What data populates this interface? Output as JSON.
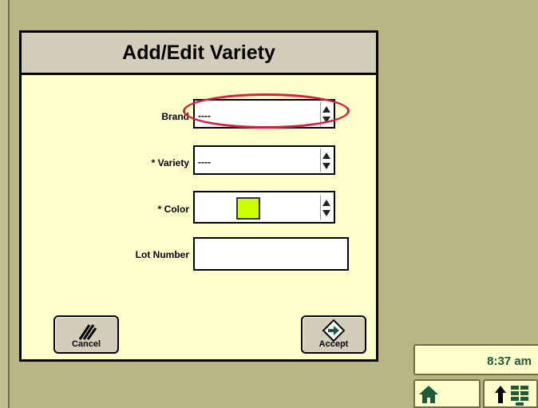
{
  "dialog": {
    "title": "Add/Edit Variety"
  },
  "fields": {
    "brand": {
      "label": "Brand",
      "value": "----"
    },
    "variety": {
      "label": "* Variety",
      "value": "----"
    },
    "color": {
      "label": "* Color",
      "swatch_color": "#ccff00"
    },
    "lot_number": {
      "label": "Lot Number",
      "value": ""
    }
  },
  "buttons": {
    "cancel": {
      "label": "Cancel",
      "icon": "cancel-slash-icon"
    },
    "accept": {
      "label": "Accept",
      "icon": "accept-arrow-icon"
    }
  },
  "status": {
    "time": "8:37 am"
  },
  "nav": {
    "home_icon": "home-icon",
    "menu_icon": "up-arrow-grid-icon"
  },
  "colors": {
    "background": "#b9b684",
    "dialog": "#ffffcc",
    "titlebar": "#d3cebc",
    "highlight": "#d4213d",
    "icon_green": "#1d5a36"
  }
}
